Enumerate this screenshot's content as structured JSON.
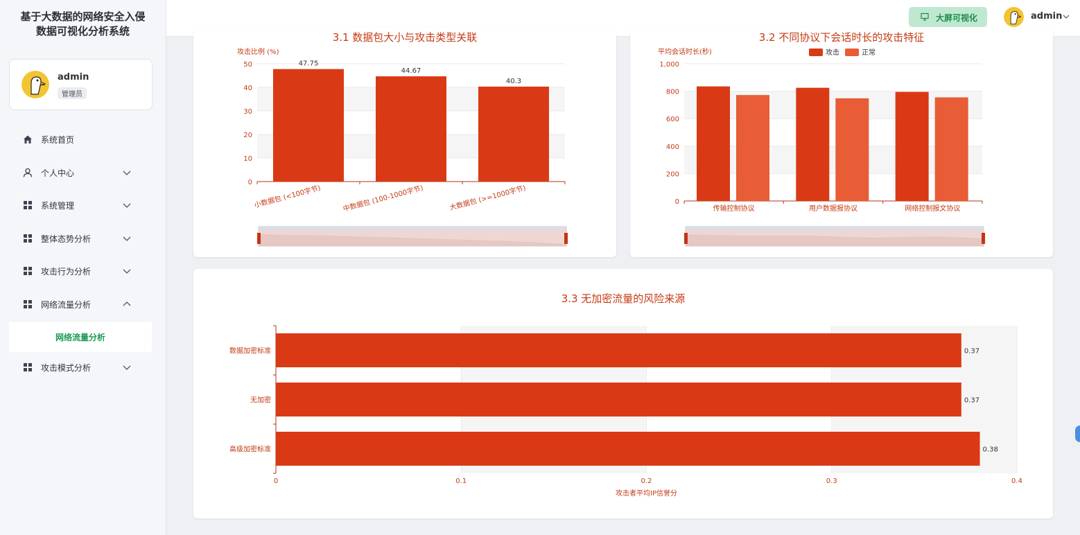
{
  "app": {
    "title_line1": "基于大数据的网络安全入侵",
    "title_line2": "数据可视化分析系统"
  },
  "user": {
    "name": "admin",
    "role": "管理员"
  },
  "topbar": {
    "screen_button": "大屏可视化",
    "username": "admin"
  },
  "sidebar": {
    "items": [
      {
        "label": "系统首页",
        "icon": "home-icon"
      },
      {
        "label": "个人中心",
        "icon": "user-icon"
      },
      {
        "label": "系统管理",
        "icon": "grid-icon"
      },
      {
        "label": "整体态势分析",
        "icon": "grid-icon"
      },
      {
        "label": "攻击行为分析",
        "icon": "grid-icon"
      },
      {
        "label": "网络流量分析",
        "icon": "grid-icon"
      },
      {
        "label": "攻击模式分析",
        "icon": "grid-icon"
      }
    ],
    "active_sub": "网络流量分析"
  },
  "colors": {
    "accent": "#d93a15",
    "accent2": "#e85c36",
    "brand_green": "#1d9a55",
    "button_bg": "#bfe8d0"
  },
  "chart_data": [
    {
      "type": "bar",
      "title": "3.1 数据包大小与攻击类型关联",
      "ylabel": "攻击比例 (%)",
      "xlabel": "",
      "categories": [
        "小数据包 (<100字节)",
        "中数据包 (100-1000字节)",
        "大数据包 (>=1000字节)"
      ],
      "values": [
        47.75,
        44.67,
        40.3
      ],
      "data_labels": [
        "47.75",
        "44.67",
        "40.3"
      ],
      "yticks": [
        "0",
        "10",
        "20",
        "30",
        "40",
        "50"
      ],
      "ylim": [
        0,
        50
      ],
      "grid": true
    },
    {
      "type": "bar",
      "title": "3.2 不同协议下会话时长的攻击特征",
      "ylabel": "平均会话时长(秒)",
      "categories": [
        "传输控制协议",
        "用户数据报协议",
        "网络控制报文协议"
      ],
      "series": [
        {
          "name": "攻击",
          "values": [
            835,
            825,
            795
          ]
        },
        {
          "name": "正常",
          "values": [
            772,
            748,
            755
          ]
        }
      ],
      "yticks": [
        "0",
        "200",
        "400",
        "600",
        "800",
        "1,000"
      ],
      "ylim": [
        0,
        1000
      ],
      "legend": "top-center",
      "grid": true
    },
    {
      "type": "bar",
      "orientation": "horizontal",
      "title": "3.3 无加密流量的风险来源",
      "xlabel": "攻击者平均IP信誉分",
      "categories": [
        "数据加密标准",
        "无加密",
        "高级加密标准"
      ],
      "values": [
        0.37,
        0.37,
        0.38
      ],
      "data_labels": [
        "0.37",
        "0.37",
        "0.38"
      ],
      "xticks": [
        "0",
        "0.1",
        "0.2",
        "0.3",
        "0.4"
      ],
      "xlim": [
        0,
        0.4
      ],
      "grid": true
    }
  ]
}
